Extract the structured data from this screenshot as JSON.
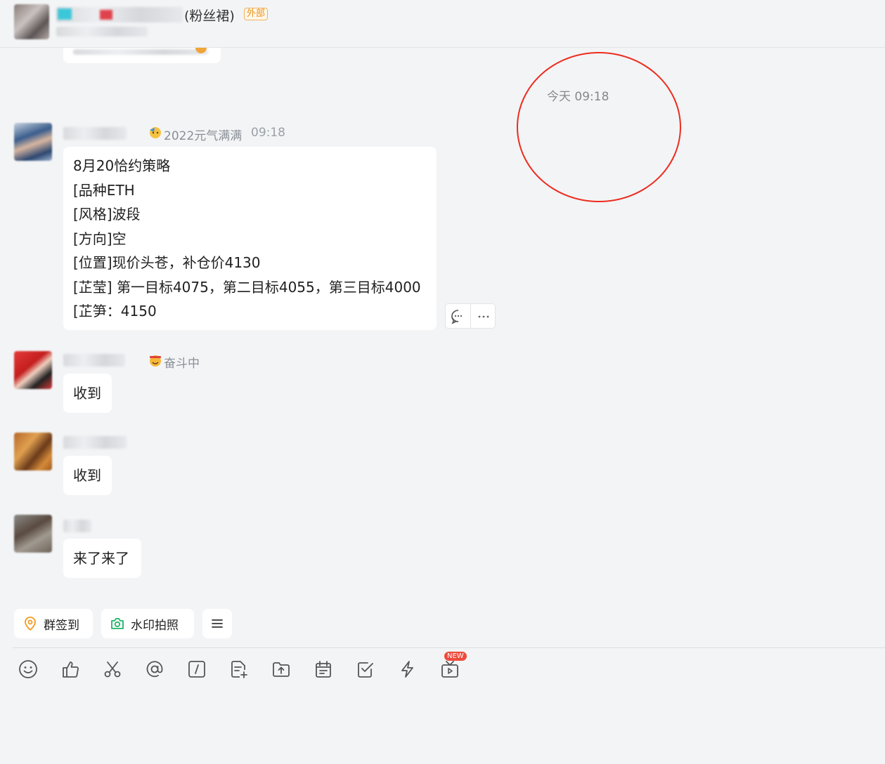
{
  "header": {
    "group_name_suffix": "(粉丝裙)",
    "external_badge": "外部"
  },
  "timestamp_divider": "今天 09:18",
  "messages": [
    {
      "sender_status": "2022元气满满",
      "time": "09:18",
      "lines": [
        "8月20恰约策略",
        "[品种ETH",
        "[风格]波段",
        "[方向]空",
        "[位置]现价头苍，补仓价4130",
        "[芷莹] 第一目标4075，第二目标4055，第三目标4000",
        "[芷笋：4150"
      ]
    },
    {
      "sender_status": "奋斗中",
      "text": "收到"
    },
    {
      "text": "收到"
    },
    {
      "text": "来了来了"
    }
  ],
  "quick_actions": {
    "checkin": "群签到",
    "watermark_photo": "水印拍照"
  },
  "toolbar": {
    "icons": [
      "emoji-icon",
      "thumbs-up-icon",
      "scissors-icon",
      "at-icon",
      "slash-command-icon",
      "new-doc-icon",
      "upload-file-icon",
      "schedule-icon",
      "task-check-icon",
      "lightning-icon",
      "live-video-icon"
    ],
    "new_badge": "NEW"
  },
  "colors": {
    "background": "#f3f4f6",
    "annotation_circle": "#ec2d1f",
    "external_badge": "#e7941a",
    "new_badge": "#ef4a3c"
  }
}
